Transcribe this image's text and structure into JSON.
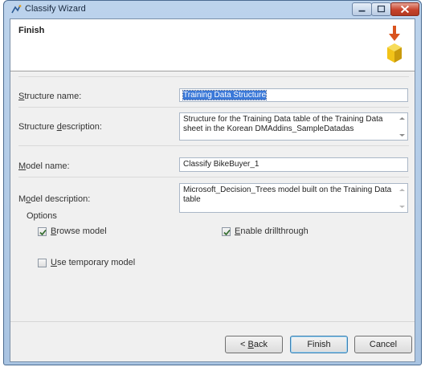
{
  "window": {
    "title": "Classify Wizard",
    "icon": "wizard-app-icon",
    "controls": [
      "minimize-icon",
      "maximize-icon",
      "close-icon"
    ]
  },
  "header": {
    "title": "Finish",
    "icon": "mining-model-arrow-cube-icon"
  },
  "form": {
    "structure_name": {
      "label_key": "S",
      "label_rest": "tructure name:",
      "value": "Training Data Structure",
      "selected": true
    },
    "structure_description": {
      "label_pre": "Structure ",
      "label_key": "d",
      "label_rest": "escription:",
      "value": "Structure for the Training Data table of the Training Data sheet in the Korean DMAddins_SampleDatadas"
    },
    "model_name": {
      "label_key": "M",
      "label_rest": "odel name:",
      "value": "Classify BikeBuyer_1"
    },
    "model_description": {
      "label_pre": "M",
      "label_key": "o",
      "label_rest": "del description:",
      "value": "Microsoft_Decision_Trees model built on the Training Data table"
    }
  },
  "options": {
    "heading": "Options",
    "browse_model": {
      "key": "B",
      "rest": "rowse model",
      "checked": true
    },
    "enable_drillthrough": {
      "key": "E",
      "rest": "nable drillthrough",
      "checked": true
    },
    "use_temporary_model": {
      "key": "U",
      "rest": "se temporary model",
      "checked": false
    }
  },
  "buttons": {
    "back_prefix": "< ",
    "back_key": "B",
    "back_rest": "ack",
    "finish": "Finish",
    "cancel": "Cancel"
  },
  "colors": {
    "selection": "#3a78d8",
    "check": "#2f6a2a",
    "header_arrow": "#d9531e",
    "header_cube": "#f2c318"
  }
}
